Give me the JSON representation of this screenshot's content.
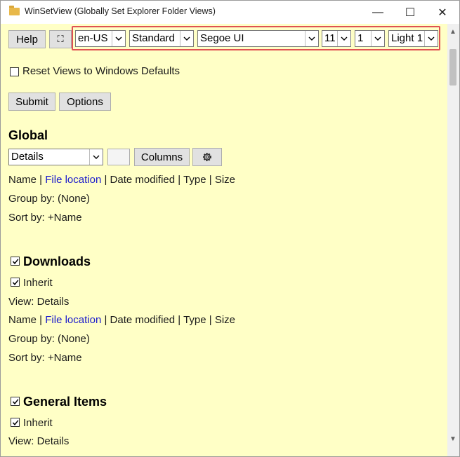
{
  "window": {
    "title": "WinSetView (Globally Set Explorer Folder Views)",
    "controls": {
      "minimize": "—",
      "maximize": "☐",
      "close": "✕"
    }
  },
  "toolbar": {
    "help_label": "Help",
    "fullscreen_icon": "⛶",
    "language": "en-US",
    "mode": "Standard",
    "font": "Segoe UI",
    "font_size": "11",
    "scale": "1",
    "theme": "Light 1"
  },
  "reset": {
    "label": "Reset Views to Windows Defaults",
    "checked": false
  },
  "actions": {
    "submit_label": "Submit",
    "options_label": "Options"
  },
  "global": {
    "heading": "Global",
    "view_select": "Details",
    "columns_label": "Columns",
    "columns": [
      "Name",
      "File location",
      "Date modified",
      "Type",
      "Size"
    ],
    "sep": " | ",
    "group_by": "Group by: (None)",
    "sort_by": "Sort by: +Name"
  },
  "downloads": {
    "heading": "Downloads",
    "checked": true,
    "inherit_label": "Inherit",
    "inherit_checked": true,
    "view": "View: Details",
    "columns": [
      "Name",
      "File location",
      "Date modified",
      "Type",
      "Size"
    ],
    "group_by": "Group by: (None)",
    "sort_by": "Sort by: +Name"
  },
  "general_items": {
    "heading": "General Items",
    "checked": true,
    "inherit_label": "Inherit",
    "inherit_checked": true,
    "view": "View: Details"
  },
  "colors": {
    "background": "#ffffc6",
    "link": "#1a1acc",
    "highlight": "#e05252"
  }
}
